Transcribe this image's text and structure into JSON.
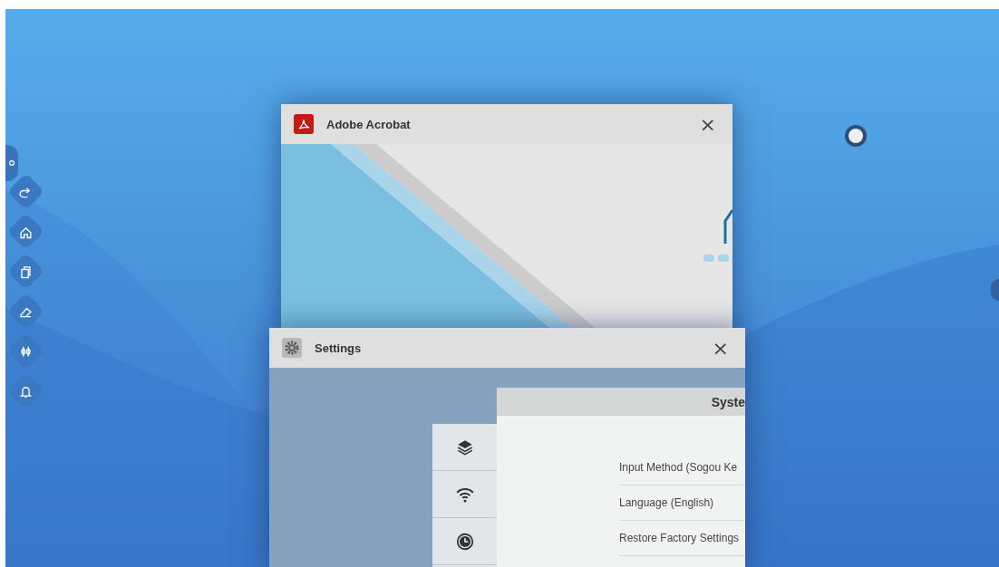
{
  "dock": [
    {
      "kind": "redo"
    },
    {
      "kind": "home"
    },
    {
      "kind": "pages"
    },
    {
      "kind": "eraser"
    },
    {
      "kind": "tools"
    },
    {
      "kind": "bell"
    }
  ],
  "windows": [
    {
      "kind": "acrobat",
      "title": "Adobe Acrobat",
      "close": "×"
    },
    {
      "kind": "settings",
      "title": "Settings",
      "close": "×",
      "panel_title": "Syste",
      "categories": [
        {
          "kind": "layers",
          "selected": false
        },
        {
          "kind": "wifi",
          "selected": false
        },
        {
          "kind": "clock",
          "selected": false
        }
      ],
      "items": [
        "Input Method (Sogou Ke",
        "Language (English)",
        "Restore Factory Settings"
      ]
    }
  ]
}
